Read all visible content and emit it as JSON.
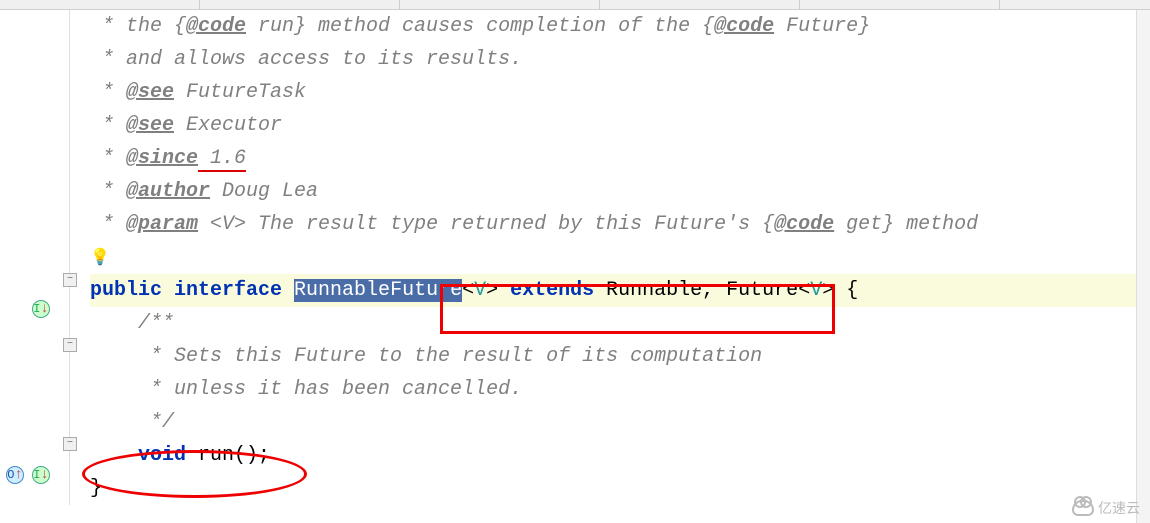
{
  "javadoc": {
    "line1_prefix": " * the {",
    "line1_code": "@code",
    "line1_mid": " run} method causes completion of the {",
    "line1_code2": "@code",
    "line1_end": " Future}",
    "line2": " * and allows access to its results.",
    "see1_prefix": " * ",
    "see1_tag": "@see",
    "see1_val": " FutureTask",
    "see2_prefix": " * ",
    "see2_tag": "@see",
    "see2_val": " Executor",
    "since_prefix": " * ",
    "since_tag": "@since",
    "since_val": " 1.6",
    "author_prefix": " * ",
    "author_tag": "@author",
    "author_val": " Doug Lea",
    "param_prefix": " * ",
    "param_tag": "@param",
    "param_tv": " <V>",
    "param_desc_1": " The result type returned by this Future's {",
    "param_code": "@code",
    "param_desc_2": " get} method",
    "method_doc1": "    /**",
    "method_doc2": "     * Sets this Future to the result of its computation",
    "method_doc3": "     * unless it has been cancelled.",
    "method_doc4": "     */"
  },
  "decl": {
    "public": "public ",
    "interface": "interface ",
    "name": "RunnableFuture",
    "lt": "<",
    "v": "V",
    "gt": ">",
    "extends": " extends ",
    "runnable": "Runnable, Future",
    "lt2": "<",
    "v2": "V",
    "gt2": ">",
    "brace": " {"
  },
  "method": {
    "indent": "    ",
    "void": "void ",
    "name": "run",
    "parens": "();"
  },
  "close_brace": "}",
  "icons": {
    "bulb": "💡",
    "fold_minus": "−",
    "gutter_I": "I",
    "gutter_O": "O",
    "arrow_up": "↑",
    "arrow_down": "↓"
  },
  "watermark": "亿速云"
}
